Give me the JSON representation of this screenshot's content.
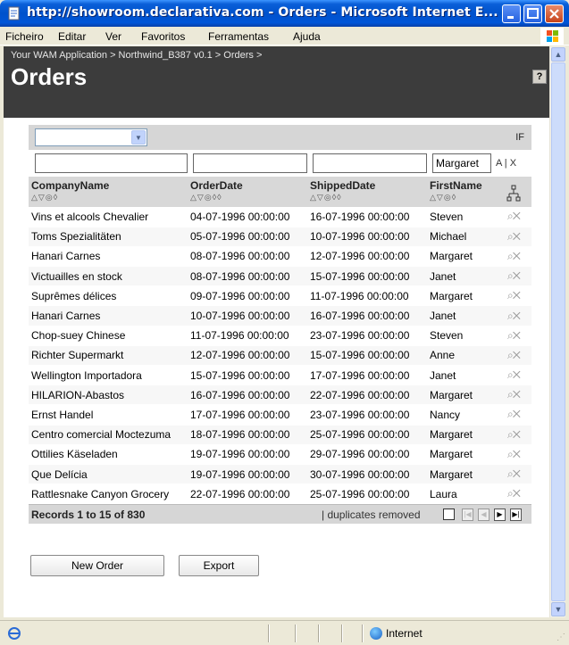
{
  "window": {
    "title": "http://showroom.declarativa.com - Orders - Microsoft Internet E...",
    "buttons": [
      "minimize",
      "maximize",
      "close"
    ]
  },
  "menu": {
    "items": [
      "Ficheiro",
      "Editar",
      "Ver",
      "Favoritos",
      "Ferramentas",
      "Ajuda"
    ]
  },
  "page": {
    "breadcrumb": "Your WAM Application > Northwind_B387 v0.1 > Orders >",
    "title": "Orders",
    "help_label": "?"
  },
  "grid": {
    "toolbar": {
      "select_value": "",
      "if_label": "IF"
    },
    "filters": {
      "company": "",
      "orderdate": "",
      "shippeddate": "",
      "firstname": "Margaret",
      "ax_label": "A | X"
    },
    "columns": [
      {
        "label": "CompanyName",
        "sort_icons": "△▽◎◊"
      },
      {
        "label": "OrderDate",
        "sort_icons": "△▽◎◊◊"
      },
      {
        "label": "ShippedDate",
        "sort_icons": "△▽◎◊◊"
      },
      {
        "label": "FirstName",
        "sort_icons": "△▽◎◊"
      }
    ],
    "rows": [
      [
        "Vins et alcools Chevalier",
        "04-07-1996 00:00:00",
        "16-07-1996 00:00:00",
        "Steven"
      ],
      [
        "Toms Spezialitäten",
        "05-07-1996 00:00:00",
        "10-07-1996 00:00:00",
        "Michael"
      ],
      [
        "Hanari Carnes",
        "08-07-1996 00:00:00",
        "12-07-1996 00:00:00",
        "Margaret"
      ],
      [
        "Victuailles en stock",
        "08-07-1996 00:00:00",
        "15-07-1996 00:00:00",
        "Janet"
      ],
      [
        "Suprêmes délices",
        "09-07-1996 00:00:00",
        "11-07-1996 00:00:00",
        "Margaret"
      ],
      [
        "Hanari Carnes",
        "10-07-1996 00:00:00",
        "16-07-1996 00:00:00",
        "Janet"
      ],
      [
        "Chop-suey Chinese",
        "11-07-1996 00:00:00",
        "23-07-1996 00:00:00",
        "Steven"
      ],
      [
        "Richter Supermarkt",
        "12-07-1996 00:00:00",
        "15-07-1996 00:00:00",
        "Anne"
      ],
      [
        "Wellington Importadora",
        "15-07-1996 00:00:00",
        "17-07-1996 00:00:00",
        "Janet"
      ],
      [
        "HILARION-Abastos",
        "16-07-1996 00:00:00",
        "22-07-1996 00:00:00",
        "Margaret"
      ],
      [
        "Ernst Handel",
        "17-07-1996 00:00:00",
        "23-07-1996 00:00:00",
        "Nancy"
      ],
      [
        "Centro comercial Moctezuma",
        "18-07-1996 00:00:00",
        "25-07-1996 00:00:00",
        "Margaret"
      ],
      [
        "Ottilies Käseladen",
        "19-07-1996 00:00:00",
        "29-07-1996 00:00:00",
        "Margaret"
      ],
      [
        "Que Delícia",
        "19-07-1996 00:00:00",
        "30-07-1996 00:00:00",
        "Margaret"
      ],
      [
        "Rattlesnake Canyon Grocery",
        "22-07-1996 00:00:00",
        "25-07-1996 00:00:00",
        "Laura"
      ]
    ],
    "footer": {
      "records": "Records 1 to 15 of 830",
      "duplicates": "| duplicates removed"
    }
  },
  "actions": {
    "new_order": "New Order",
    "export": "Export"
  },
  "statusbar": {
    "zone": "Internet"
  },
  "icons": {
    "row_view": "magnifier-icon",
    "row_delete": "delete-x-icon",
    "column_config": "tree-icon"
  },
  "colors": {
    "titlebar": "#0052cc",
    "page_header": "#3c3c3c",
    "grid_header": "#d8d8d8"
  }
}
